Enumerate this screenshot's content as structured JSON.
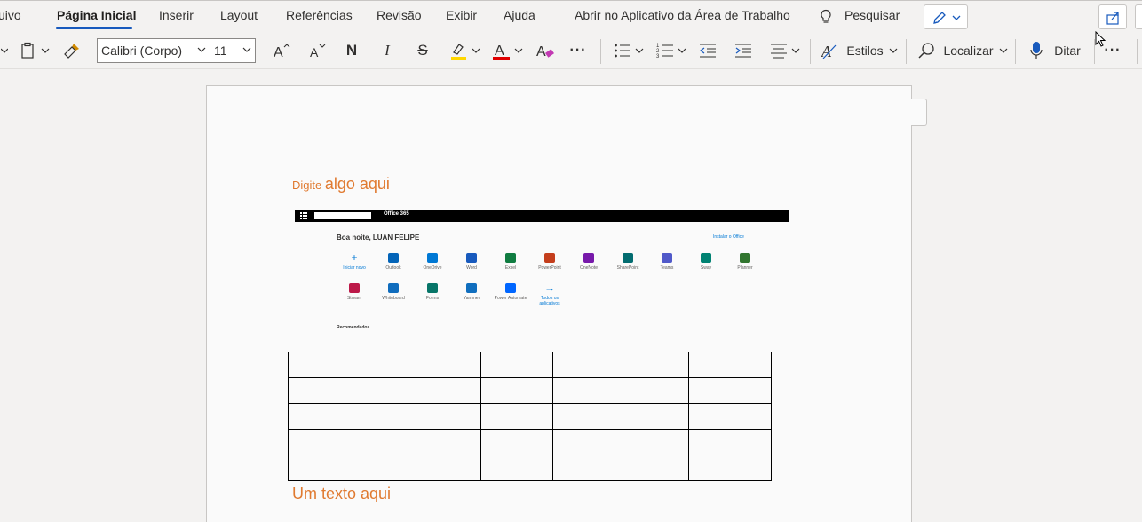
{
  "menu": {
    "tabs": [
      "uivo",
      "Página Inicial",
      "Inserir",
      "Layout",
      "Referências",
      "Revisão",
      "Exibir",
      "Ajuda",
      "Abrir no Aplicativo da Área de Trabalho"
    ],
    "active_tab": "Página Inicial",
    "search_label": "Pesquisar"
  },
  "ribbon": {
    "font_name": "Calibri (Corpo)",
    "font_size": "11",
    "bold_glyph": "N",
    "italic_glyph": "I",
    "strike_glyph": "S",
    "more_glyph": "···",
    "styles_label": "Estilos",
    "find_label": "Localizar",
    "dictate_label": "Ditar",
    "highlight_color": "#ffd700",
    "font_color": "#e00000"
  },
  "document": {
    "heading_small": "Digite ",
    "heading_big": "algo aqui",
    "bottom_text": "Um texto aqui",
    "text_color": "#e07a30",
    "table_rows": 5,
    "table_cols": 4
  },
  "office_shot": {
    "brand": "Office 365",
    "greeting": "Boa noite, LUAN FELIPE",
    "install": "Instalar o Office",
    "apps_row1": [
      {
        "name": "Iniciar novo",
        "icon": "plus-icon",
        "color": "#0078d4"
      },
      {
        "name": "Outlook",
        "icon": "outlook-icon",
        "color": "#0364b8"
      },
      {
        "name": "OneDrive",
        "icon": "onedrive-icon",
        "color": "#0078d4"
      },
      {
        "name": "Word",
        "icon": "word-icon",
        "color": "#185abd"
      },
      {
        "name": "Excel",
        "icon": "excel-icon",
        "color": "#107c41"
      },
      {
        "name": "PowerPoint",
        "icon": "powerpoint-icon",
        "color": "#c43e1c"
      },
      {
        "name": "OneNote",
        "icon": "onenote-icon",
        "color": "#7719aa"
      },
      {
        "name": "SharePoint",
        "icon": "sharepoint-icon",
        "color": "#036c70"
      },
      {
        "name": "Teams",
        "icon": "teams-icon",
        "color": "#5059c9"
      },
      {
        "name": "Sway",
        "icon": "sway-icon",
        "color": "#008272"
      },
      {
        "name": "Planner",
        "icon": "planner-icon",
        "color": "#31752f"
      }
    ],
    "apps_row2": [
      {
        "name": "Stream",
        "icon": "stream-icon",
        "color": "#bc1948"
      },
      {
        "name": "Whiteboard",
        "icon": "whiteboard-icon",
        "color": "#0f6cbd"
      },
      {
        "name": "Forms",
        "icon": "forms-icon",
        "color": "#077568"
      },
      {
        "name": "Yammer",
        "icon": "yammer-icon",
        "color": "#106ebe"
      },
      {
        "name": "Power Automate",
        "icon": "power-automate-icon",
        "color": "#0066ff"
      },
      {
        "name": "Todos os aplicativos",
        "icon": "arrow-right-icon",
        "color": "#0078d4"
      }
    ],
    "recommended": "Recomendados"
  }
}
